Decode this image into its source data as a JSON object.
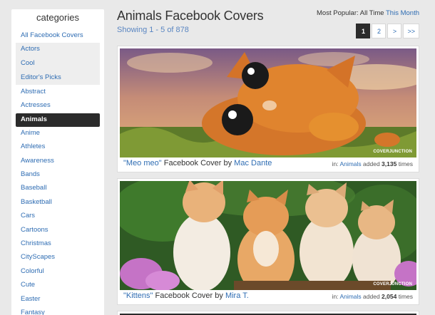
{
  "sidebar": {
    "title": "categories",
    "items": [
      {
        "label": "All Facebook Covers",
        "style": "plain"
      },
      {
        "label": "Actors",
        "style": "shaded"
      },
      {
        "label": "Cool",
        "style": "shaded"
      },
      {
        "label": "Editor's Picks",
        "style": "shaded"
      },
      {
        "label": "Abstract",
        "style": "plain"
      },
      {
        "label": "Actresses",
        "style": "plain"
      },
      {
        "label": "Animals",
        "style": "active"
      },
      {
        "label": "Anime",
        "style": "plain"
      },
      {
        "label": "Athletes",
        "style": "plain"
      },
      {
        "label": "Awareness",
        "style": "plain"
      },
      {
        "label": "Bands",
        "style": "plain"
      },
      {
        "label": "Baseball",
        "style": "plain"
      },
      {
        "label": "Basketball",
        "style": "plain"
      },
      {
        "label": "Cars",
        "style": "plain"
      },
      {
        "label": "Cartoons",
        "style": "plain"
      },
      {
        "label": "Christmas",
        "style": "plain"
      },
      {
        "label": "CityScapes",
        "style": "plain"
      },
      {
        "label": "Colorful",
        "style": "plain"
      },
      {
        "label": "Cute",
        "style": "plain"
      },
      {
        "label": "Easter",
        "style": "plain"
      },
      {
        "label": "Fantasy",
        "style": "plain"
      }
    ]
  },
  "header": {
    "title": "Animals Facebook Covers",
    "showing": "Showing 1 - 5 of 878",
    "popular_label": "Most Popular: All Time",
    "popular_link": "This Month"
  },
  "pager": [
    "1",
    "2",
    ">",
    ">>"
  ],
  "covers": [
    {
      "open_quote": "\"",
      "name": "Meo meo",
      "close_quote": "\"",
      "suffix": " Facebook Cover by ",
      "author": "Mac Dante",
      "in_label": "in: ",
      "category": "Animals",
      "added_label": " added ",
      "count": "3,135",
      "times_label": " times",
      "watermark": "COVERJUNCTION"
    },
    {
      "open_quote": "\"",
      "name": "Kittens",
      "close_quote": "\"",
      "suffix": " Facebook Cover by ",
      "author": "Mira T.",
      "in_label": "in: ",
      "category": "Animals",
      "added_label": " added ",
      "count": "2,054",
      "times_label": " times",
      "watermark": "COVERJUNCTION"
    }
  ],
  "colors": {
    "link": "#2f6db3",
    "active_bg": "#2b2b2b",
    "page_bg": "#e9e9e9"
  }
}
